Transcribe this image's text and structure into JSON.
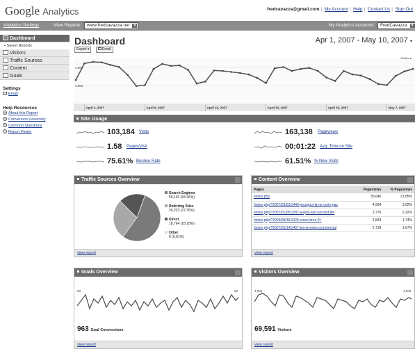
{
  "header": {
    "logo_google": "Google",
    "logo_analytics": "Analytics",
    "email": "fredcavazza@gmail.com",
    "links": [
      "My Account",
      "Help",
      "Contact Us",
      "Sign Out"
    ]
  },
  "navbar": {
    "settings": "Analytics Settings",
    "view_reports_label": "View Reports:",
    "site": "www.fredcavazza.net",
    "accounts_label": "My Analytics Accounts:",
    "account": "FredCavazza"
  },
  "sidebar": {
    "dashboard": "Dashboard",
    "saved_reports": "• Saved Reports",
    "items": [
      "Visitors",
      "Traffic Sources",
      "Content",
      "Goals"
    ],
    "settings_head": "Settings",
    "settings_link": "Email",
    "help_head": "Help Resources",
    "help_links": [
      "About this Report",
      "Conversion University",
      "Common Questions",
      "Report Finder"
    ]
  },
  "main": {
    "title": "Dashboard",
    "export_btn": "Export ▾",
    "email_btn": "Email",
    "date_range": "Apr 1, 2007 - May 10, 2007",
    "visits_selector": "Visits ▾",
    "y_top": "4,000",
    "y_mid": "2,000",
    "x_labels": [
      "April 2, 2007",
      "April 9, 2007",
      "April 16, 2007",
      "April 23, 2007",
      "April 30, 2007",
      "May 7, 2007"
    ]
  },
  "chart_data": {
    "type": "line",
    "title": "",
    "ylim": [
      0,
      4000
    ],
    "y_ticks": [
      "2,000",
      "4,000"
    ],
    "x_ticks": [
      "April 2, 2007",
      "April 9, 2007",
      "April 16, 2007",
      "April 23, 2007",
      "April 30, 2007",
      "May 7, 2007"
    ],
    "series": [
      {
        "values": [
          2200,
          3850,
          4000,
          3950,
          3700,
          3500,
          2700,
          1600,
          1700,
          3300,
          3800,
          3600,
          3650,
          3200,
          1850,
          2050,
          3150,
          3100,
          3000,
          2900,
          2750,
          2400,
          1900,
          3350,
          3500,
          3100,
          3300,
          3400,
          3100,
          2450,
          2100,
          3100,
          2750,
          2650,
          2300,
          1800,
          1700,
          2600,
          3050,
          3300
        ]
      }
    ]
  },
  "site_usage": {
    "title": "Site Usage",
    "metrics": [
      {
        "value": "103,184",
        "label": "Visits"
      },
      {
        "value": "1.58",
        "label": "Pages/Visit"
      },
      {
        "value": "75.61%",
        "label": "Bounce Rate"
      },
      {
        "value": "163,138",
        "label": "Pageviews"
      },
      {
        "value": "00:01:22",
        "label": "Avg. Time on Site"
      },
      {
        "value": "61.51%",
        "label": "% New Visits"
      }
    ]
  },
  "traffic": {
    "title": "Traffic Sources Overview",
    "view_report": "view report",
    "slices": [
      {
        "name": "Search Engines",
        "detail": "56,191 (54.46%)",
        "value": 54.46,
        "color": "#7a7a7a"
      },
      {
        "name": "Referring Sites",
        "detail": "26,223 (27.35%)",
        "value": 27.35,
        "color": "#a8a8a8"
      },
      {
        "name": "Direct",
        "detail": "18,764 (18.18%)",
        "value": 18.18,
        "color": "#555555"
      },
      {
        "name": "Other",
        "detail": "6 (0.01%)",
        "value": 0.01,
        "color": "#dddddd"
      }
    ]
  },
  "content": {
    "title": "Content Overview",
    "view_report": "view report",
    "headers": [
      "Pages",
      "Pageviews",
      "% Pageviews"
    ],
    "rows": [
      [
        "/index.php",
        "35,640",
        "21.85%"
      ],
      [
        "/index.php/?2007/03/03/1440-pourquoi-la-ne-croie-pas",
        "4,934",
        "3.02%"
      ],
      [
        "/index.php/?2007/01/05/1287-a-quoi-sert-second-life",
        "3,776",
        "2.32%"
      ],
      [
        "/index.php/?2006/08/30/1226-croce-bres-2f-",
        "2,843",
        "1.74%"
      ],
      [
        "/index.php/?2007/03/14/1457-les-envoies-commercial",
        "2,718",
        "1.67%"
      ]
    ]
  },
  "goals": {
    "title": "Goals Overview",
    "view_report": "view report",
    "value": "963",
    "label": "Goal Conversions",
    "y_left": "50",
    "y_right": "50"
  },
  "visitors": {
    "title": "Visitors Overview",
    "view_report": "view report",
    "value": "69,591",
    "label": "Visitors",
    "y_left": "4,000",
    "y_right": "4,000"
  },
  "colors": {
    "bar": "#6b6b6b",
    "line": "#555555"
  }
}
